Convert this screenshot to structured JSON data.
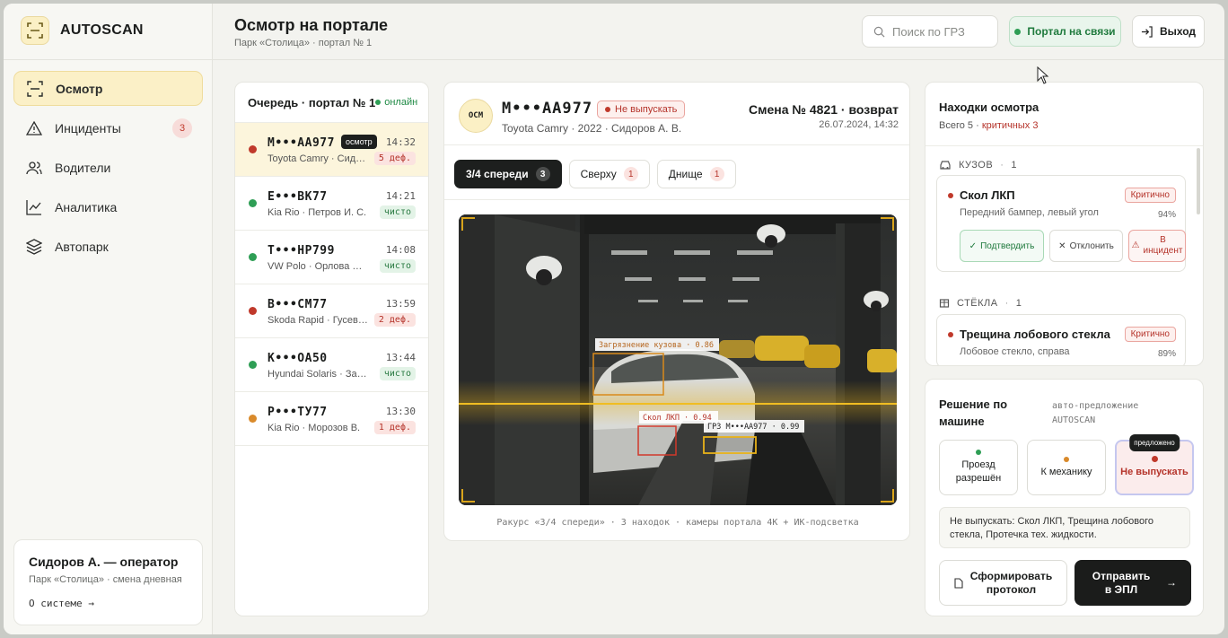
{
  "brand": {
    "name": "AUTOSCAN"
  },
  "nav": {
    "items": [
      {
        "label": "Осмотр",
        "icon": "scan-icon",
        "active": true
      },
      {
        "label": "Инциденты",
        "icon": "warning-icon",
        "badge": "3"
      },
      {
        "label": "Водители",
        "icon": "users-icon"
      },
      {
        "label": "Аналитика",
        "icon": "chart-icon"
      },
      {
        "label": "Автопарк",
        "icon": "layers-icon"
      }
    ]
  },
  "user": {
    "name": "Сидоров А. — оператор",
    "sub": "Парк «Столица» · смена дневная",
    "link": "О системе →"
  },
  "header": {
    "title": "Осмотр на портале",
    "sub": "Парк «Столица» · портал № 1",
    "search_placeholder": "Поиск по ГРЗ",
    "status": "Портал на связи",
    "logout": "Выход"
  },
  "queue": {
    "title": "Очередь · портал № 1",
    "online": "онлайн",
    "rows": [
      {
        "plate": "М•••АА977",
        "tag": "осмотр",
        "time": "14:32",
        "car": "Toyota Camry · Сидоров А. В.",
        "status": "5 деф.",
        "kind": "def",
        "dot": "#c0392b"
      },
      {
        "plate": "Е•••ВК77",
        "time": "14:21",
        "car": "Kia Rio · Петров И. С.",
        "status": "чисто",
        "kind": "ok",
        "dot": "#2e9e55"
      },
      {
        "plate": "Т•••НР799",
        "time": "14:08",
        "car": "VW Polo · Орлова М. А.",
        "status": "чисто",
        "kind": "ok",
        "dot": "#2e9e55"
      },
      {
        "plate": "В•••СМ77",
        "time": "13:59",
        "car": "Skoda Rapid · Гусев Д. О.",
        "status": "2 деф.",
        "kind": "def",
        "dot": "#c0392b"
      },
      {
        "plate": "К•••ОА50",
        "time": "13:44",
        "car": "Hyundai Solaris · Зайцев П.",
        "status": "чисто",
        "kind": "ok",
        "dot": "#2e9e55"
      },
      {
        "plate": "Р•••ТУ77",
        "time": "13:30",
        "car": "Kia Rio · Морозов В.",
        "status": "1 деф.",
        "kind": "def",
        "dot": "#d98a2b"
      }
    ]
  },
  "vehicle": {
    "badge": "ОСМ",
    "plate": "М•••АА977",
    "flag": "Не выпускать",
    "car": "Toyota Camry · 2022 · Сидоров А. В.",
    "shift": "Смена № 4821 · возврат",
    "date": "26.07.2024, 14:32"
  },
  "tabs": [
    {
      "label": "3/4 спереди",
      "count": "3",
      "active": true
    },
    {
      "label": "Сверху",
      "count": "1"
    },
    {
      "label": "Днище",
      "count": "1"
    }
  ],
  "camera": {
    "box_dirt": "Загрязнение кузова · 0.86",
    "box_chip": "Скол ЛКП · 0.94",
    "box_plate": "ГРЗ М•••АА977 · 0.99",
    "caption": "Ракурс «3/4 спереди» · 3 находок · камеры портала 4K + ИК-подсветка"
  },
  "findings": {
    "title": "Находки осмотра",
    "total": "Всего 5 ·",
    "critical": "критичных 3",
    "groups": [
      {
        "label": "КУЗОВ",
        "count": "1"
      },
      {
        "label": "СТЁКЛА",
        "count": "1"
      }
    ],
    "cards": [
      {
        "title": "Скол ЛКП",
        "sub": "Передний бампер, левый угол",
        "level": "Критично",
        "pct": "94%"
      },
      {
        "title": "Трещина лобового стекла",
        "sub": "Лобовое стекло, справа",
        "level": "Критично",
        "pct": "89%"
      }
    ],
    "actions": {
      "confirm": "Подтвердить",
      "reject": "Отклонить",
      "incident": "В инцидент"
    }
  },
  "decision": {
    "title": "Решение по машине",
    "auto": "авто-предложение AUTOSCAN",
    "options": [
      {
        "label": "Проезд разрешён",
        "color": "#2e9e55"
      },
      {
        "label": "К механику",
        "color": "#d98a2b"
      },
      {
        "label": "Не выпускать",
        "color": "#c0392b",
        "selected": true
      }
    ],
    "proposed": "предложено",
    "reason": "Не выпускать: Скол ЛКП, Трещина лобового стекла, Протечка тех. жидкости.",
    "protocol": "Сформировать протокол",
    "send": "Отправить в ЭПЛ"
  }
}
